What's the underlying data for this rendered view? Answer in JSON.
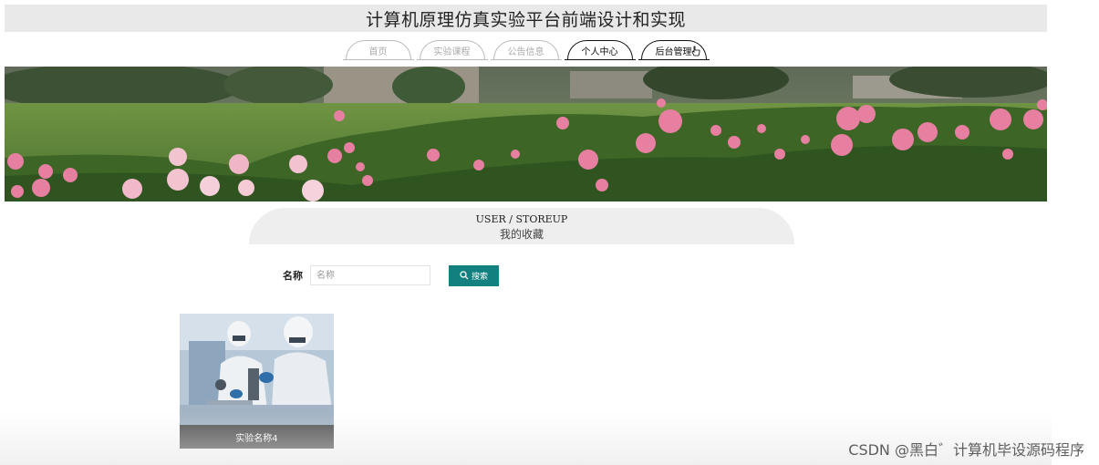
{
  "header": {
    "title": "计算机原理仿真实验平台前端设计和实现"
  },
  "nav": {
    "tabs": [
      {
        "label": "首页"
      },
      {
        "label": "实验课程"
      },
      {
        "label": "公告信息"
      },
      {
        "label": "个人中心"
      },
      {
        "label": "后台管理"
      }
    ]
  },
  "section": {
    "title_en": "USER / STOREUP",
    "title_cn": "我的收藏"
  },
  "search": {
    "label": "名称",
    "placeholder": "名称",
    "value": "",
    "button_label": "搜索",
    "button_color": "#11807f"
  },
  "favorites": [
    {
      "name": "实验名称4"
    }
  ],
  "watermark": "CSDN @黑白゛计算机毕设源码程序"
}
